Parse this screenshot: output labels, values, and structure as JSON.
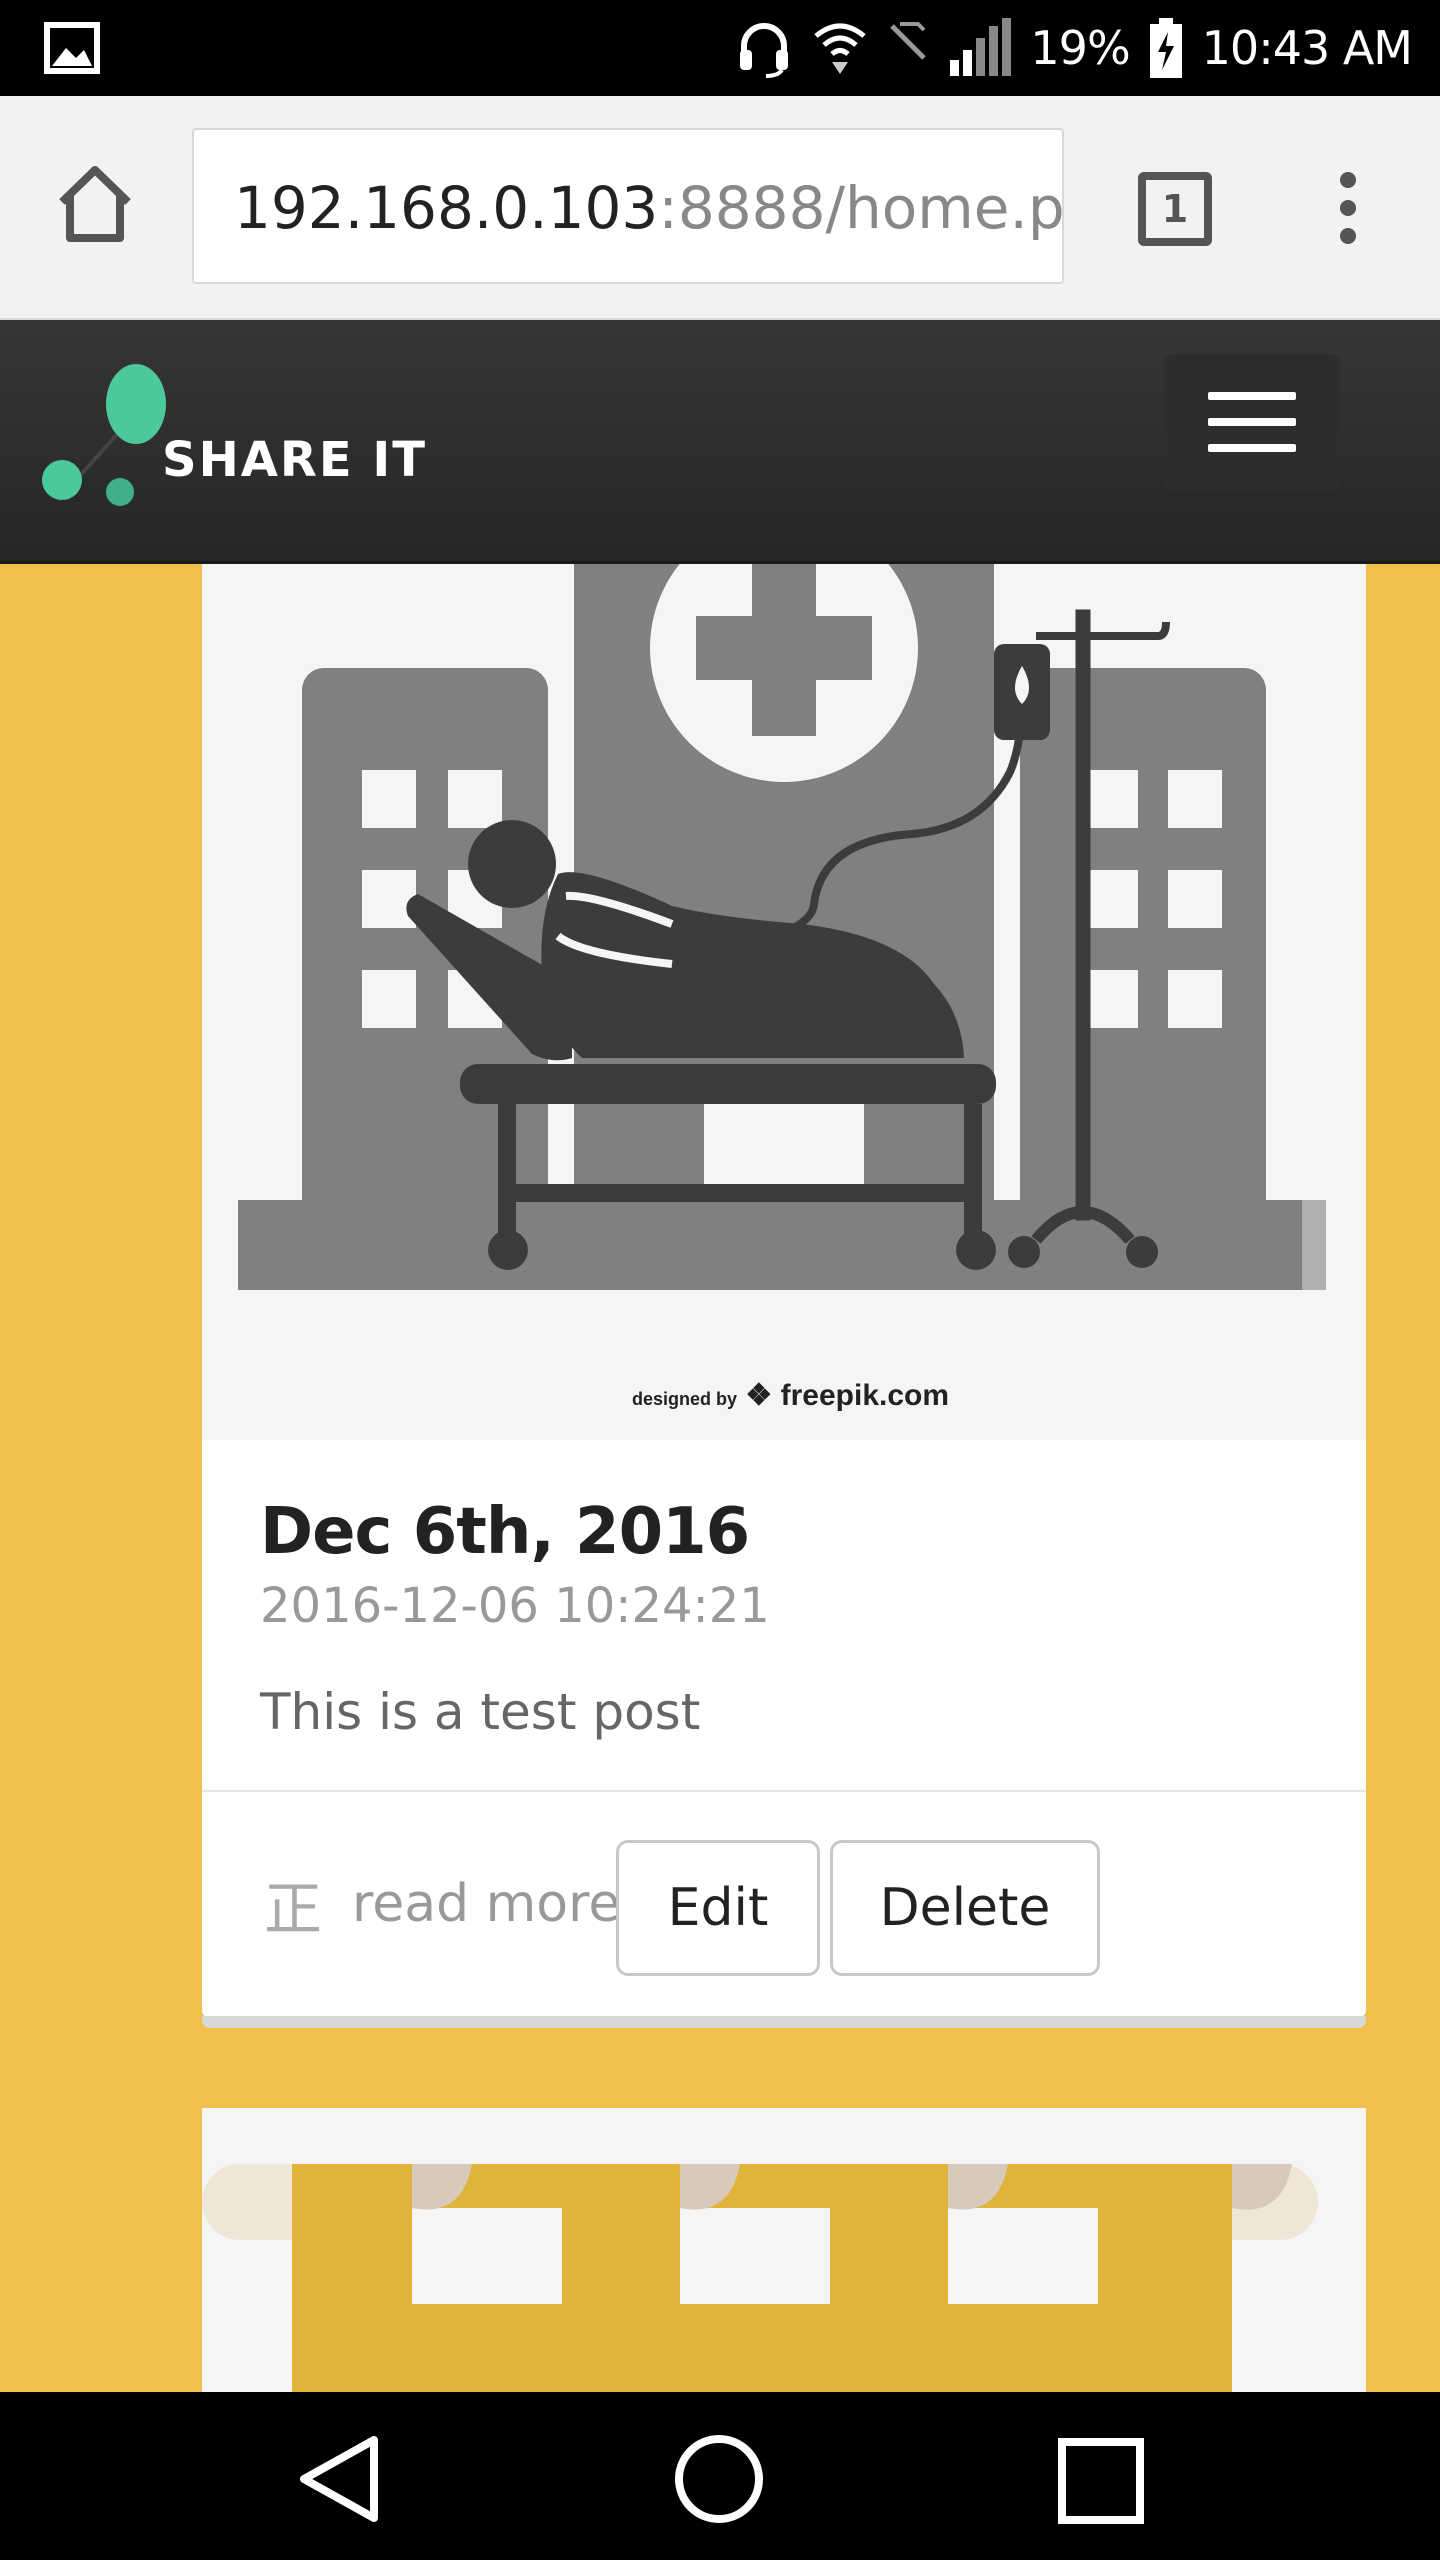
{
  "status_bar": {
    "battery": "19%",
    "time": "10:43 AM",
    "icons": [
      "gallery-icon",
      "headset-icon",
      "wifi-icon",
      "no-sim-icon",
      "signal-icon",
      "battery-charging-icon"
    ]
  },
  "browser": {
    "url_host": "192.168.0.103",
    "url_path": ":8888/home.p",
    "tab_count": "1",
    "icons": [
      "home-icon",
      "tabs-icon",
      "overflow-menu-icon"
    ]
  },
  "app": {
    "brand": "SHARE IT",
    "colors": {
      "header": "#2e2e2e",
      "background": "#f0c04c",
      "logo_green": "#4cc99a"
    }
  },
  "posts": [
    {
      "image_credit_prefix": "designed by",
      "image_credit": "freepik.com",
      "title": "Dec 6th, 2016",
      "timestamp": "2016-12-06 10:24:21",
      "body": "This is a test post",
      "read_more": "read more",
      "edit_label": "Edit",
      "delete_label": "Delete"
    }
  ],
  "nav_bar": {
    "icons": [
      "back-icon",
      "home-circle-icon",
      "recents-icon"
    ]
  }
}
